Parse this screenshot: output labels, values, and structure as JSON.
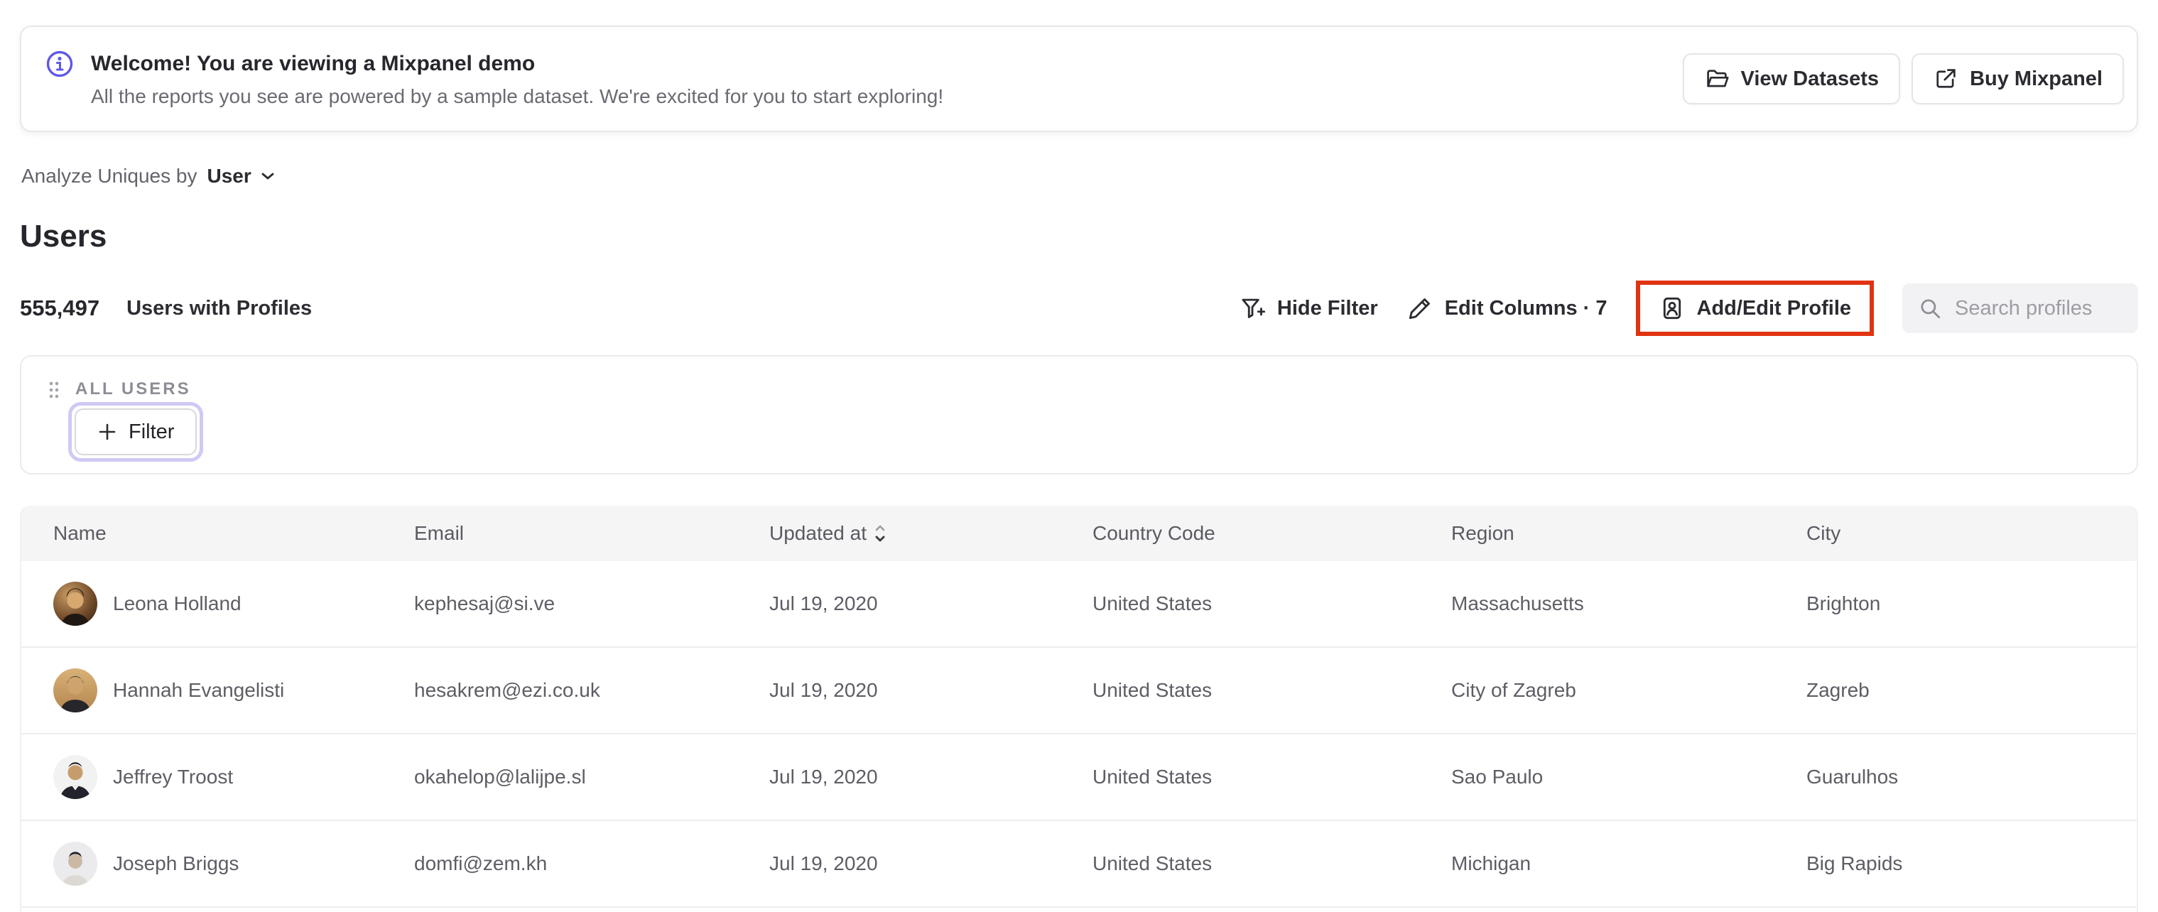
{
  "banner": {
    "title": "Welcome! You are viewing a Mixpanel demo",
    "subtitle": "All the reports you see are powered by a sample dataset. We're excited for you to start exploring!",
    "view_datasets_label": "View Datasets",
    "buy_mixpanel_label": "Buy Mixpanel"
  },
  "analyze": {
    "label": "Analyze Uniques by",
    "value": "User"
  },
  "page": {
    "title": "Users",
    "count": "555,497",
    "count_label": "Users with Profiles"
  },
  "toolbar": {
    "hide_filter_label": "Hide Filter",
    "edit_columns_label": "Edit Columns · 7",
    "add_edit_profile_label": "Add/Edit Profile",
    "search_placeholder": "Search profiles"
  },
  "filter_panel": {
    "group_label": "ALL USERS",
    "filter_button_label": "Filter"
  },
  "table": {
    "columns": [
      "Name",
      "Email",
      "Updated at",
      "Country Code",
      "Region",
      "City"
    ],
    "rows": [
      {
        "name": "Leona Holland",
        "email": "kephesaj@si.ve",
        "updated": "Jul 19, 2020",
        "country": "United States",
        "region": "Massachusetts",
        "city": "Brighton"
      },
      {
        "name": "Hannah Evangelisti",
        "email": "hesakrem@ezi.co.uk",
        "updated": "Jul 19, 2020",
        "country": "United States",
        "region": "City of Zagreb",
        "city": "Zagreb"
      },
      {
        "name": "Jeffrey Troost",
        "email": "okahelop@lalijpe.sl",
        "updated": "Jul 19, 2020",
        "country": "United States",
        "region": "Sao Paulo",
        "city": "Guarulhos"
      },
      {
        "name": "Joseph Briggs",
        "email": "domfi@zem.kh",
        "updated": "Jul 19, 2020",
        "country": "United States",
        "region": "Michigan",
        "city": "Big Rapids"
      }
    ]
  },
  "icons": {
    "info-icon": "circled-i",
    "folder-icon": "open-folder",
    "external-link-icon": "arrow-out-of-box",
    "chevron-down-icon": "chevron-down",
    "funnel-plus-icon": "filter-funnel-plus",
    "pencil-icon": "edit-pencil",
    "id-card-icon": "profile-badge",
    "search-icon": "magnifier",
    "drag-handle-icon": "six-dots",
    "plus-icon": "plus",
    "sort-icon": "caret-up-down"
  },
  "colors": {
    "accent": "#6157e8",
    "highlight": "#e03312",
    "ring": "#cfc9f5"
  }
}
